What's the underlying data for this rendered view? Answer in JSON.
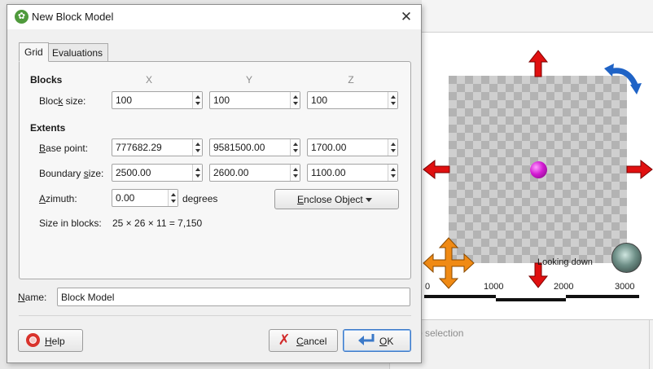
{
  "dialog": {
    "title": "New Block Model",
    "tabs": [
      {
        "label": "Grid",
        "active": true
      },
      {
        "label": "Evaluations",
        "active": false
      }
    ],
    "blocks_heading": "Blocks",
    "axis_labels": [
      "X",
      "Y",
      "Z"
    ],
    "block_size": {
      "label_pre": "Bloc",
      "label_key": "k",
      "label_post": " size:",
      "x": "100",
      "y": "100",
      "z": "100"
    },
    "extents_heading": "Extents",
    "base_point": {
      "label_key": "B",
      "label_post": "ase point:",
      "x": "777682.29",
      "y": "9581500.00",
      "z": "1700.00"
    },
    "boundary_size": {
      "label_pre": "Boundary ",
      "label_key": "s",
      "label_post": "ize:",
      "x": "2500.00",
      "y": "2600.00",
      "z": "1100.00"
    },
    "azimuth": {
      "label_key": "A",
      "label_post": "zimuth:",
      "value": "0.00",
      "unit": "degrees"
    },
    "enclose_button": {
      "label_key": "E",
      "label_post": "nclose Object"
    },
    "size_in_blocks": {
      "label": "Size in blocks:",
      "value": "25 × 26 × 11 = 7,150"
    },
    "name": {
      "label_key": "N",
      "label_post": "ame:",
      "value": "Block Model"
    },
    "buttons": {
      "help": {
        "label_key": "H",
        "label_post": "elp"
      },
      "cancel": {
        "label_key": "C",
        "label_post": "ancel"
      },
      "ok": {
        "label_key": "O",
        "label_post": "K"
      }
    }
  },
  "scene": {
    "looking_label": "Looking down",
    "scale_labels": [
      "0",
      "1000",
      "2000",
      "3000"
    ],
    "colors": {
      "axis_arrow": "#e01010",
      "rotate_arrow": "#1f63c6",
      "move_arrow": "#f08a14",
      "sphere": "#d21ad2"
    }
  },
  "selection_panel": {
    "text": "o selection"
  },
  "icons": [
    "app-logo-icon",
    "close-icon",
    "spin-up-icon",
    "spin-down-icon",
    "dropdown-caret-icon",
    "help-lifebuoy-icon",
    "cancel-x-icon",
    "ok-enter-icon",
    "globe-icon",
    "rotate-arrow-icon",
    "move-arrows-icon"
  ]
}
